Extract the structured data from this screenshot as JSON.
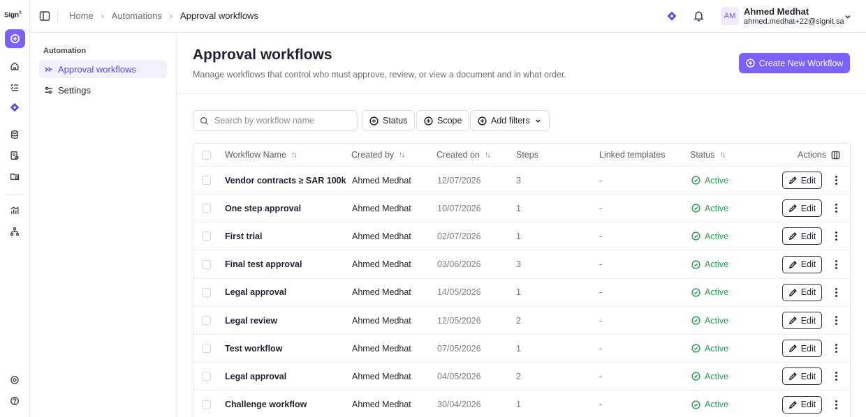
{
  "app": {
    "logo": "Sign",
    "logo_sup": "it"
  },
  "header": {
    "breadcrumb": [
      "Home",
      "Automations",
      "Approval workflows"
    ],
    "user": {
      "initials": "AM",
      "name": "Ahmed Medhat",
      "email": "ahmed.medhat+22@signit.sa"
    }
  },
  "rail": {
    "icons": [
      "add-circle-icon",
      "home-icon",
      "tasks-icon",
      "automation-icon",
      "database-icon",
      "documents-icon",
      "folder-icon",
      "analytics-icon",
      "hierarchy-icon",
      "settings-icon",
      "help-icon"
    ]
  },
  "subnav": {
    "heading": "Automation",
    "items": [
      {
        "label": "Approval workflows",
        "icon": "workflow-icon",
        "active": true
      },
      {
        "label": "Settings",
        "icon": "sliders-icon",
        "active": false
      }
    ]
  },
  "page": {
    "title": "Approval workflows",
    "subtitle": "Manage workflows that control who must approve, review, or view a document and in what order.",
    "create_label": "Create New Workflow"
  },
  "filters": {
    "search_placeholder": "Search by workflow name",
    "status_label": "Status",
    "scope_label": "Scope",
    "add_filters_label": "Add filters"
  },
  "table": {
    "columns": {
      "name": "Workflow Name",
      "created_by": "Created by",
      "created_on": "Created on",
      "steps": "Steps",
      "linked": "Linked templates",
      "status": "Status",
      "actions": "Actions"
    },
    "edit_label": "Edit",
    "rows": [
      {
        "name": "Vendor contracts ≥ SAR 100k",
        "created_by": "Ahmed Medhat",
        "created_on": "12/07/2026",
        "steps": "3",
        "linked": "-",
        "status": "Active"
      },
      {
        "name": "One step approval",
        "created_by": "Ahmed Medhat",
        "created_on": "10/07/2026",
        "steps": "1",
        "linked": "-",
        "status": "Active"
      },
      {
        "name": "First trial",
        "created_by": "Ahmed Medhat",
        "created_on": "02/07/2026",
        "steps": "1",
        "linked": "-",
        "status": "Active"
      },
      {
        "name": "Final test approval",
        "created_by": "Ahmed Medhat",
        "created_on": "03/06/2026",
        "steps": "3",
        "linked": "-",
        "status": "Active"
      },
      {
        "name": "Legal approval",
        "created_by": "Ahmed Medhat",
        "created_on": "14/05/2026",
        "steps": "1",
        "linked": "-",
        "status": "Active"
      },
      {
        "name": "Legal review",
        "created_by": "Ahmed Medhat",
        "created_on": "12/05/2026",
        "steps": "2",
        "linked": "-",
        "status": "Active"
      },
      {
        "name": "Test workflow",
        "created_by": "Ahmed Medhat",
        "created_on": "07/05/2026",
        "steps": "1",
        "linked": "-",
        "status": "Active"
      },
      {
        "name": "Legal approval",
        "created_by": "Ahmed Medhat",
        "created_on": "04/05/2026",
        "steps": "2",
        "linked": "-",
        "status": "Active"
      },
      {
        "name": "Challenge workflow",
        "created_by": "Ahmed Medhat",
        "created_on": "30/04/2026",
        "steps": "1",
        "linked": "-",
        "status": "Active"
      }
    ]
  },
  "colors": {
    "accent": "#7b61ff",
    "active_status": "#2f9e55",
    "active_nav_bg": "#f1f0fd"
  }
}
